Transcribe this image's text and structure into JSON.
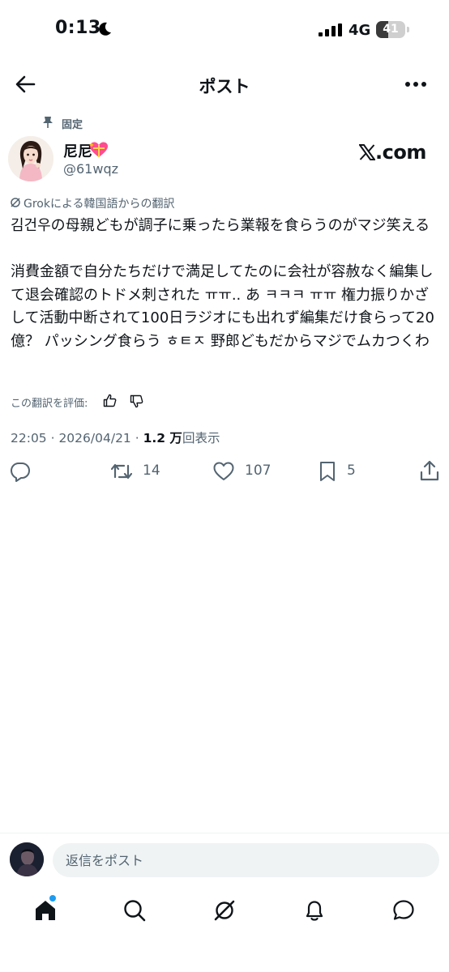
{
  "status_bar": {
    "time": "0:13",
    "network": "4G",
    "battery": "41",
    "battery_level": 0.41
  },
  "header": {
    "title": "ポスト"
  },
  "post": {
    "pinned_label": "固定",
    "author_name": "尼尼",
    "author_handle": "@61wqz",
    "xcom_label": ".com",
    "translation_label": "Grokによる韓国語からの翻訳",
    "body": "김건우の母親どもが調子に乗ったら業報を食らうのがマジ笑える\n\n消費金額で自分たちだけで満足してたのに会社が容赦なく編集して退会確認のトドメ刺された ㅠㅠ.. あ ㅋㅋㅋ ㅠㅠ 権力振りかざして活動中断されて100日ラジオにも出れず編集だけ食らって20億？ パッシング食らう ㅎㅌㅈ 野郎どもだからマジでムカつくわ",
    "rate_label": "この翻訳を評価:",
    "timestamp": "22:05 · 2026/04/21 · ",
    "views_count": "1.2 万",
    "views_label": "回表示",
    "retweets": "14",
    "likes": "107",
    "bookmarks": "5"
  },
  "reply_bar": {
    "placeholder": "返信をポスト"
  },
  "colors": {
    "accent": "#1d9bf0",
    "secondary_text": "#536471",
    "primary_text": "#0f1419"
  },
  "icons": [
    "back-arrow-icon",
    "more-icon",
    "pin-icon",
    "grok-icon",
    "thumb-up-icon",
    "thumb-down-icon",
    "reply-icon",
    "retweet-icon",
    "heart-icon",
    "bookmark-icon",
    "share-icon",
    "home-icon",
    "search-icon",
    "bell-icon",
    "message-icon"
  ]
}
